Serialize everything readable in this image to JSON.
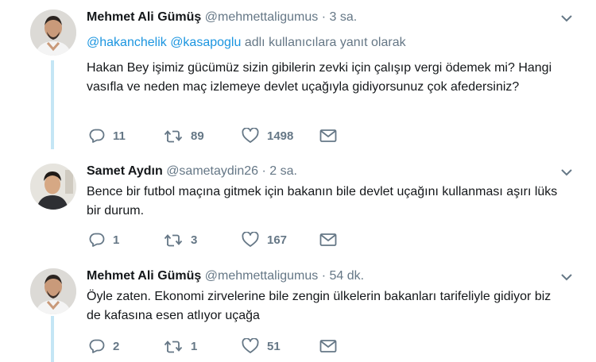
{
  "tweets": [
    {
      "name": "Mehmet Ali Gümüş",
      "handle": "@mehmettaligumus",
      "separator": "·",
      "time": "3 sa.",
      "replying": {
        "mentions": "@hakanchelik @kasapoglu",
        "suffix": " adlı kullanıcılara yanıt olarak"
      },
      "text": "Hakan Bey işimiz gücümüz sizin gibilerin zevki için çalışıp vergi ödemek mi? Hangi vasıfla ve neden maç izlemeye devlet uçağıyla gidiyorsunuz çok afedersiniz?",
      "replies": "11",
      "retweets": "89",
      "likes": "1498"
    },
    {
      "name": "Samet Aydın",
      "handle": "@sametaydin26",
      "separator": "·",
      "time": "2 sa.",
      "text": "Bence bir futbol maçına gitmek için bakanın bile devlet uçağını kullanması aşırı lüks bir durum.",
      "replies": "1",
      "retweets": "3",
      "likes": "167"
    },
    {
      "name": "Mehmet Ali Gümüş",
      "handle": "@mehmettaligumus",
      "separator": "·",
      "time": "54 dk.",
      "text": "Öyle zaten. Ekonomi zirvelerine bile zengin ülkelerin bakanları tarifeliyle gidiyor biz de kafasına esen atlıyor uçağa",
      "replies": "2",
      "retweets": "1",
      "likes": "51"
    }
  ],
  "icons": {
    "reply": "reply-icon",
    "retweet": "retweet-icon",
    "like": "heart-icon",
    "dm": "envelope-icon",
    "more": "chevron-down-icon"
  },
  "colors": {
    "link": "#1b95e0",
    "secondary": "#657786",
    "thread": "#c4e6f5"
  }
}
